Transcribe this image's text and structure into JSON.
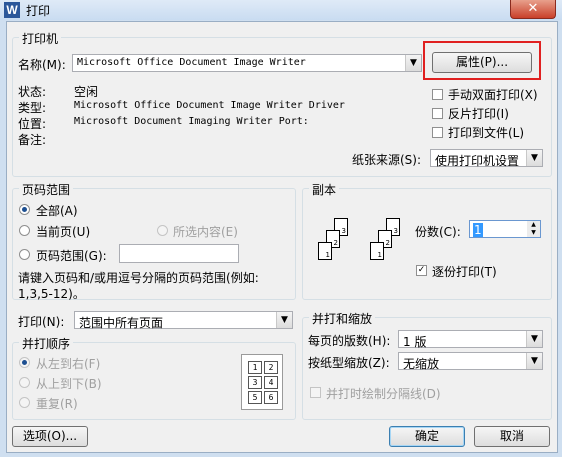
{
  "window": {
    "title": "打印",
    "app_icon": "W",
    "close_glyph": "✕"
  },
  "printer": {
    "group_label": "打印机",
    "name_label": "名称(M):",
    "name_value": "Microsoft Office Document Image Writer",
    "properties_button": "属性(P)...",
    "status_label": "状态:",
    "status_value": "空闲",
    "type_label": "类型:",
    "type_value": "Microsoft Office Document Image Writer Driver",
    "location_label": "位置:",
    "location_value": "Microsoft Document Imaging Writer Port:",
    "comment_label": "备注:",
    "manual_duplex": "手动双面打印(X)",
    "reverse_print": "反片打印(I)",
    "print_to_file": "打印到文件(L)",
    "paper_source_label": "纸张来源(S):",
    "paper_source_value": "使用打印机设置"
  },
  "page_range": {
    "group_label": "页码范围",
    "all": "全部(A)",
    "current": "当前页(U)",
    "selection": "所选内容(E)",
    "pages": "页码范围(G):",
    "pages_value": "",
    "hint_line1": "请键入页码和/或用逗号分隔的页码范围(例如:",
    "hint_line2": "1,3,5-12)。"
  },
  "copies": {
    "group_label": "副本",
    "count_label": "份数(C):",
    "count_value": "1",
    "collate": "逐份打印(T)"
  },
  "print_what": {
    "label": "打印(N):",
    "value": "范围中所有页面"
  },
  "order": {
    "group_label": "并打顺序",
    "left_to_right": "从左到右(F)",
    "top_to_bottom": "从上到下(B)",
    "repeat": "重复(R)",
    "preview_pages": [
      "1",
      "2",
      "3",
      "4",
      "5",
      "6"
    ]
  },
  "zoom": {
    "group_label": "并打和缩放",
    "pages_per_sheet_label": "每页的版数(H):",
    "pages_per_sheet_value": "1 版",
    "scale_label": "按纸型缩放(Z):",
    "scale_value": "无缩放",
    "draw_borders": "并打时绘制分隔线(D)"
  },
  "footer": {
    "options_button": "选项(O)...",
    "ok_button": "确定",
    "cancel_button": "取消"
  },
  "icons": {
    "dropdown": "▼",
    "spin_up": "▲",
    "spin_down": "▼",
    "check": "✓"
  }
}
